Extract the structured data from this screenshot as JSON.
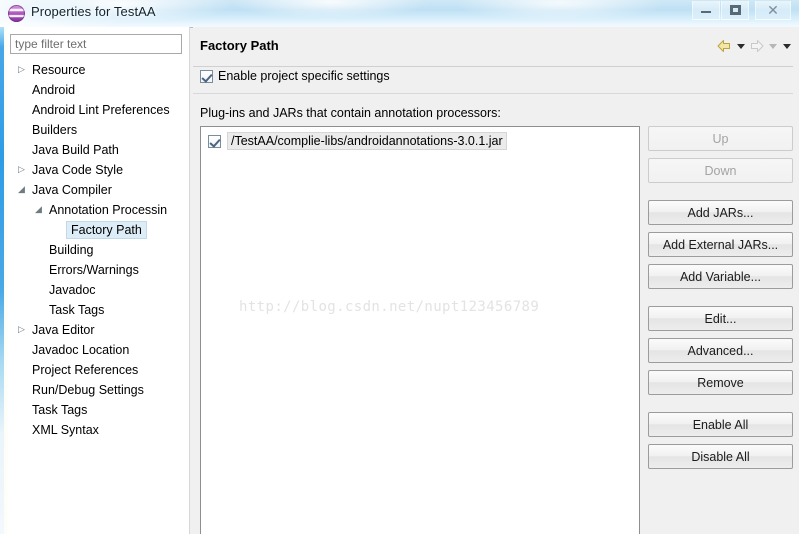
{
  "window": {
    "title": "Properties for TestAA",
    "app_icon": "eclipse-globe-icon",
    "controls": {
      "minimize": "minimize-icon",
      "maximize": "restore-icon",
      "close": "close-icon",
      "close_glyph": "✕"
    }
  },
  "sidebar": {
    "filter": {
      "placeholder": "type filter text",
      "value": ""
    },
    "items": [
      {
        "label": "Resource",
        "indent": 0,
        "arrow": "collapsed",
        "selected": false
      },
      {
        "label": "Android",
        "indent": 0,
        "arrow": "none",
        "selected": false
      },
      {
        "label": "Android Lint Preferences",
        "indent": 0,
        "arrow": "none",
        "selected": false
      },
      {
        "label": "Builders",
        "indent": 0,
        "arrow": "none",
        "selected": false
      },
      {
        "label": "Java Build Path",
        "indent": 0,
        "arrow": "none",
        "selected": false
      },
      {
        "label": "Java Code Style",
        "indent": 0,
        "arrow": "collapsed",
        "selected": false
      },
      {
        "label": "Java Compiler",
        "indent": 0,
        "arrow": "expanded",
        "selected": false
      },
      {
        "label": "Annotation Processin",
        "indent": 1,
        "arrow": "expanded",
        "selected": false
      },
      {
        "label": "Factory Path",
        "indent": 2,
        "arrow": "none",
        "selected": true
      },
      {
        "label": "Building",
        "indent": 1,
        "arrow": "none",
        "selected": false
      },
      {
        "label": "Errors/Warnings",
        "indent": 1,
        "arrow": "none",
        "selected": false
      },
      {
        "label": "Javadoc",
        "indent": 1,
        "arrow": "none",
        "selected": false
      },
      {
        "label": "Task Tags",
        "indent": 1,
        "arrow": "none",
        "selected": false
      },
      {
        "label": "Java Editor",
        "indent": 0,
        "arrow": "collapsed",
        "selected": false
      },
      {
        "label": "Javadoc Location",
        "indent": 0,
        "arrow": "none",
        "selected": false
      },
      {
        "label": "Project References",
        "indent": 0,
        "arrow": "none",
        "selected": false
      },
      {
        "label": "Run/Debug Settings",
        "indent": 0,
        "arrow": "none",
        "selected": false
      },
      {
        "label": "Task Tags",
        "indent": 0,
        "arrow": "none",
        "selected": false
      },
      {
        "label": "XML Syntax",
        "indent": 0,
        "arrow": "none",
        "selected": false
      }
    ]
  },
  "panel": {
    "title": "Factory Path",
    "nav": {
      "back_icon": "back-arrow-icon",
      "back_menu_icon": "chevron-down-icon",
      "forward_icon": "forward-arrow-icon",
      "forward_menu_icon": "chevron-down-icon",
      "view_menu_icon": "chevron-down-icon"
    },
    "enable_checkbox": {
      "label": "Enable project specific settings",
      "checked": true
    },
    "list_caption": "Plug-ins and JARs that contain annotation processors:",
    "entries": [
      {
        "path": "/TestAA/complie-libs/androidannotations-3.0.1.jar",
        "checked": true
      }
    ],
    "watermark": "http://blog.csdn.net/nupt123456789",
    "buttons": [
      {
        "label": "Up",
        "enabled": false
      },
      {
        "label": "Down",
        "enabled": false
      },
      {
        "label": "Add JARs...",
        "enabled": true
      },
      {
        "label": "Add External JARs...",
        "enabled": true
      },
      {
        "label": "Add Variable...",
        "enabled": true
      },
      {
        "label": "Edit...",
        "enabled": true
      },
      {
        "label": "Advanced...",
        "enabled": true
      },
      {
        "label": "Remove",
        "enabled": true
      },
      {
        "label": "Enable All",
        "enabled": true
      },
      {
        "label": "Disable All",
        "enabled": true
      }
    ]
  },
  "colors": {
    "titlebar_blue": "#bfe0f4",
    "selection": "#ddedf7",
    "panel_bg": "#f0f0f0",
    "nav_back": "#e8d98c",
    "nav_forward_disabled": "#dcdcdc",
    "watermark": "#e3e3e3"
  }
}
